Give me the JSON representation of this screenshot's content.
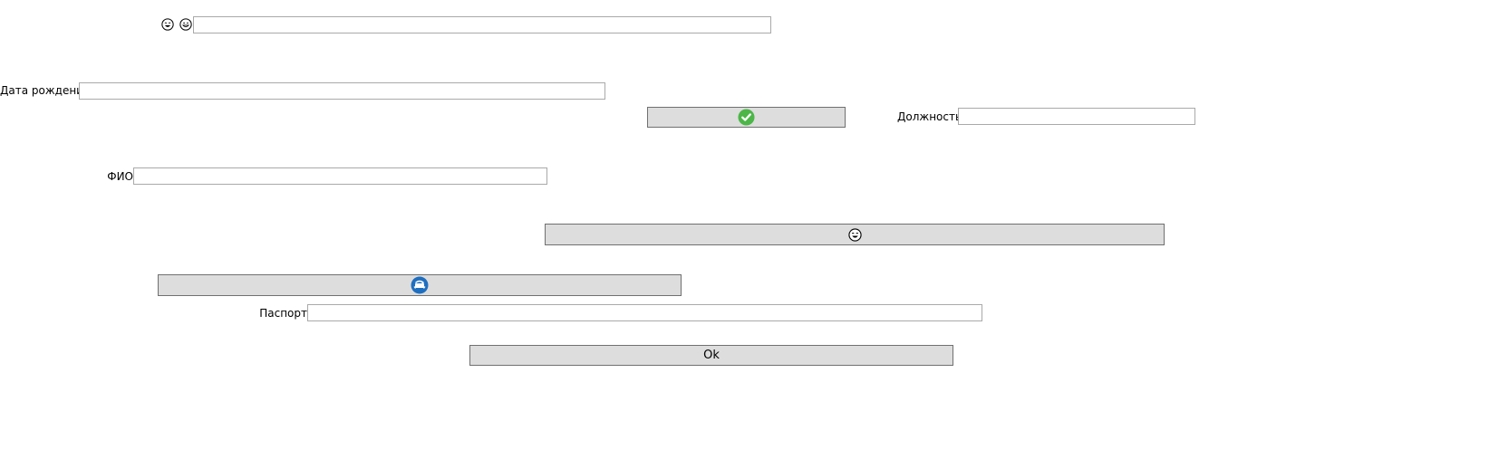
{
  "top_row": {
    "icons": [
      "laughing-face-icon",
      "grinning-face-icon"
    ],
    "input_value": ""
  },
  "birth_date": {
    "label": "Дата рождения",
    "value": ""
  },
  "confirm_button": {
    "icon": "green-checkmark-icon",
    "color": "#4cb648"
  },
  "position": {
    "label": "Должность",
    "value": ""
  },
  "fio": {
    "label": "ФИО",
    "value": ""
  },
  "emoji_button": {
    "icon": "laughing-face-icon"
  },
  "refresh_button": {
    "icon": "blue-refresh-icon",
    "color": "#1f6fc0"
  },
  "passport": {
    "label": "Паспорт",
    "value": ""
  },
  "ok_button": {
    "label": "Ok"
  }
}
